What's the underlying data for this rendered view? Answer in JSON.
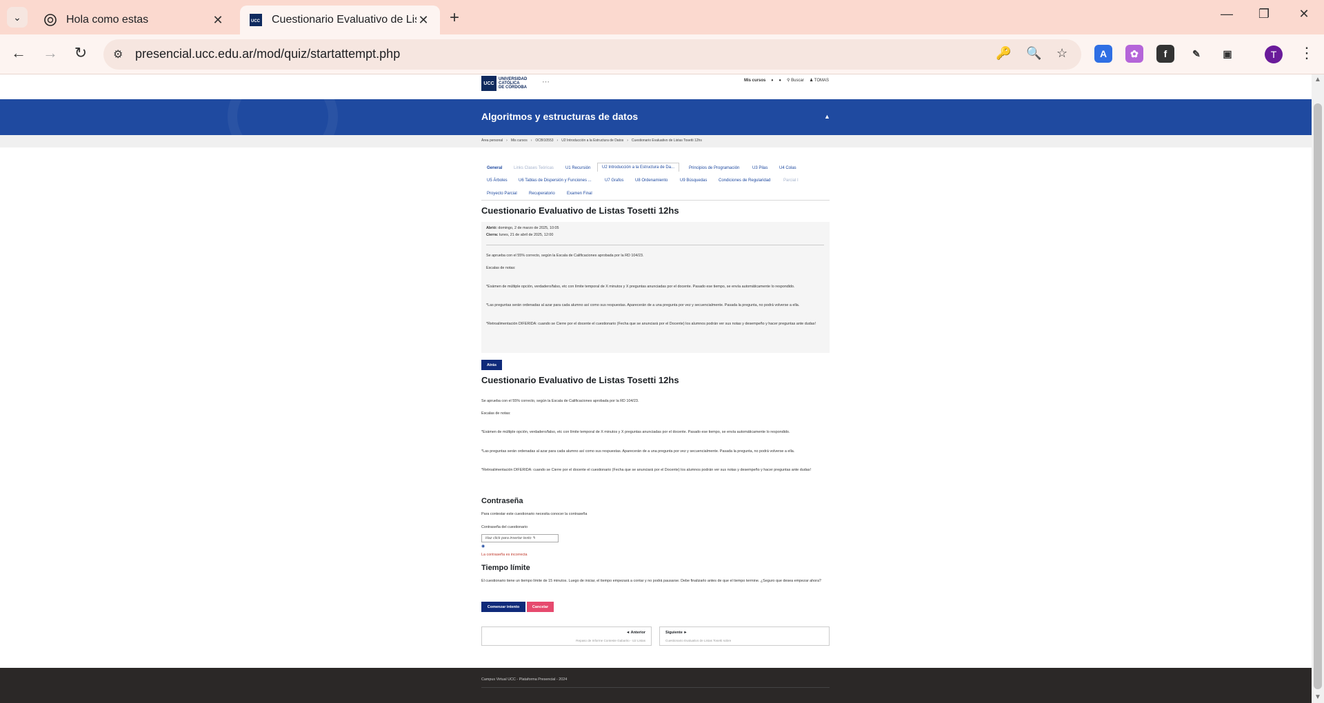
{
  "browser": {
    "tabs": [
      {
        "title": "Hola como estas",
        "icon": "chatgpt-icon"
      },
      {
        "title": "Cuestionario Evaluativo de Lista",
        "icon": "ucc-favicon"
      }
    ],
    "url": "presencial.ucc.edu.ar/mod/quiz/startattempt.php",
    "profile_initial": "T"
  },
  "site": {
    "logo_abbr": "UCC",
    "logo_text": [
      "UNIVERSIDAD",
      "CATÓLICA",
      "DE CÓRDOBA"
    ],
    "my_courses": "Mis cursos",
    "search": "Buscar",
    "user": "TOMAS"
  },
  "course_title": "Algoritmos y estructuras de datos",
  "breadcrumb": [
    "Área personal",
    "Mis cursos",
    "OCBI10553",
    "U2 Introducción a la Estructura de Datos",
    "Cuestionario Evaluativo de Listas Tosetti 12hs"
  ],
  "section_tabs": {
    "row1": [
      "General",
      "Links Clases Teóricas",
      "U1 Recursión",
      "U2 Introducción a la Estructura de Da...",
      "Principios de Programación",
      "U3 Pilas",
      "U4 Colas"
    ],
    "row2": [
      "U5 Árboles",
      "U6 Tablas de Dispersión y Funciones ...",
      "U7 Grafos",
      "U8 Ordenamiento",
      "U9 Búsquedas",
      "Condiciones de Regularidad",
      "Parcial I"
    ],
    "row3": [
      "Proyecto Parcial",
      "Recuperatorio",
      "Examen Final"
    ]
  },
  "quiz": {
    "title": "Cuestionario Evaluativo de Listas Tosetti 12hs",
    "opened_label": "Abrió:",
    "opened_value": "domingo, 2 de marzo de 2025, 10:05",
    "closes_label": "Cierra:",
    "closes_value": "lunes, 21 de abril de 2025, 12:00",
    "p1": "Se aprueba con el 55% correcto, según la Escala de Calificaciones aprobada por la RD 104/23.",
    "p2": "Escalas de notas:",
    "p3": "*Exámen de múltiple opción, verdadero/falso, etc con límite temporal de X minutos y X preguntas anunciadas por el docente. Pasado ese tiempo, se envía automáticamente lo respondido.",
    "p4": "*Las preguntas serán ordenadas al azar para cada alumno así como sus respuestas. Aparecerán de a una pregunta por vez y secuencialmente. Pasada la pregunta, no podrá volverse a ella.",
    "p5": "*Retroalimentación DIFERIDA: cuando se Cierre por el docente el cuestionario (Fecha que se anunciará por el Docente) los alumnos podrán ver sus notas y desempeño y hacer preguntas ante dudas!",
    "back_button": "Atrás"
  },
  "password": {
    "heading": "Contraseña",
    "intro": "Para contestar este cuestionario necesita conocer la contraseña",
    "label": "Contraseña del cuestionario",
    "placeholder": "Haz click para insertar texto",
    "error": "La contraseña es incorrecta"
  },
  "time_limit": {
    "heading": "Tiempo límite",
    "text": "El cuestionario tiene un tiempo límite de 15 minutos. Luego de iniciar, el tiempo empezará a contar y no podrá pausarse. Debe finalizarlo antes de que el tiempo termine. ¿Seguro que desea empezar ahora?"
  },
  "actions": {
    "start": "Comenzar intento",
    "cancel": "Cancelar"
  },
  "activity_nav": {
    "prev_label": "◄ Anterior",
    "prev_title": "Repaso de Informe Conteste Gabarito - U2 Listas",
    "next_label": "Siguiente ►",
    "next_title": "Cuestionario Evaluativo de Listas Tosetti sobre"
  },
  "footer": "Campus Virtual UCC - Plataforma Presencial - 2024",
  "colors": {
    "banner": "#1f4aa0",
    "primary": "#0f2a7a",
    "cancel": "#e64a6e",
    "footer": "#2b2827",
    "tabbar": "#fbd9cf"
  }
}
